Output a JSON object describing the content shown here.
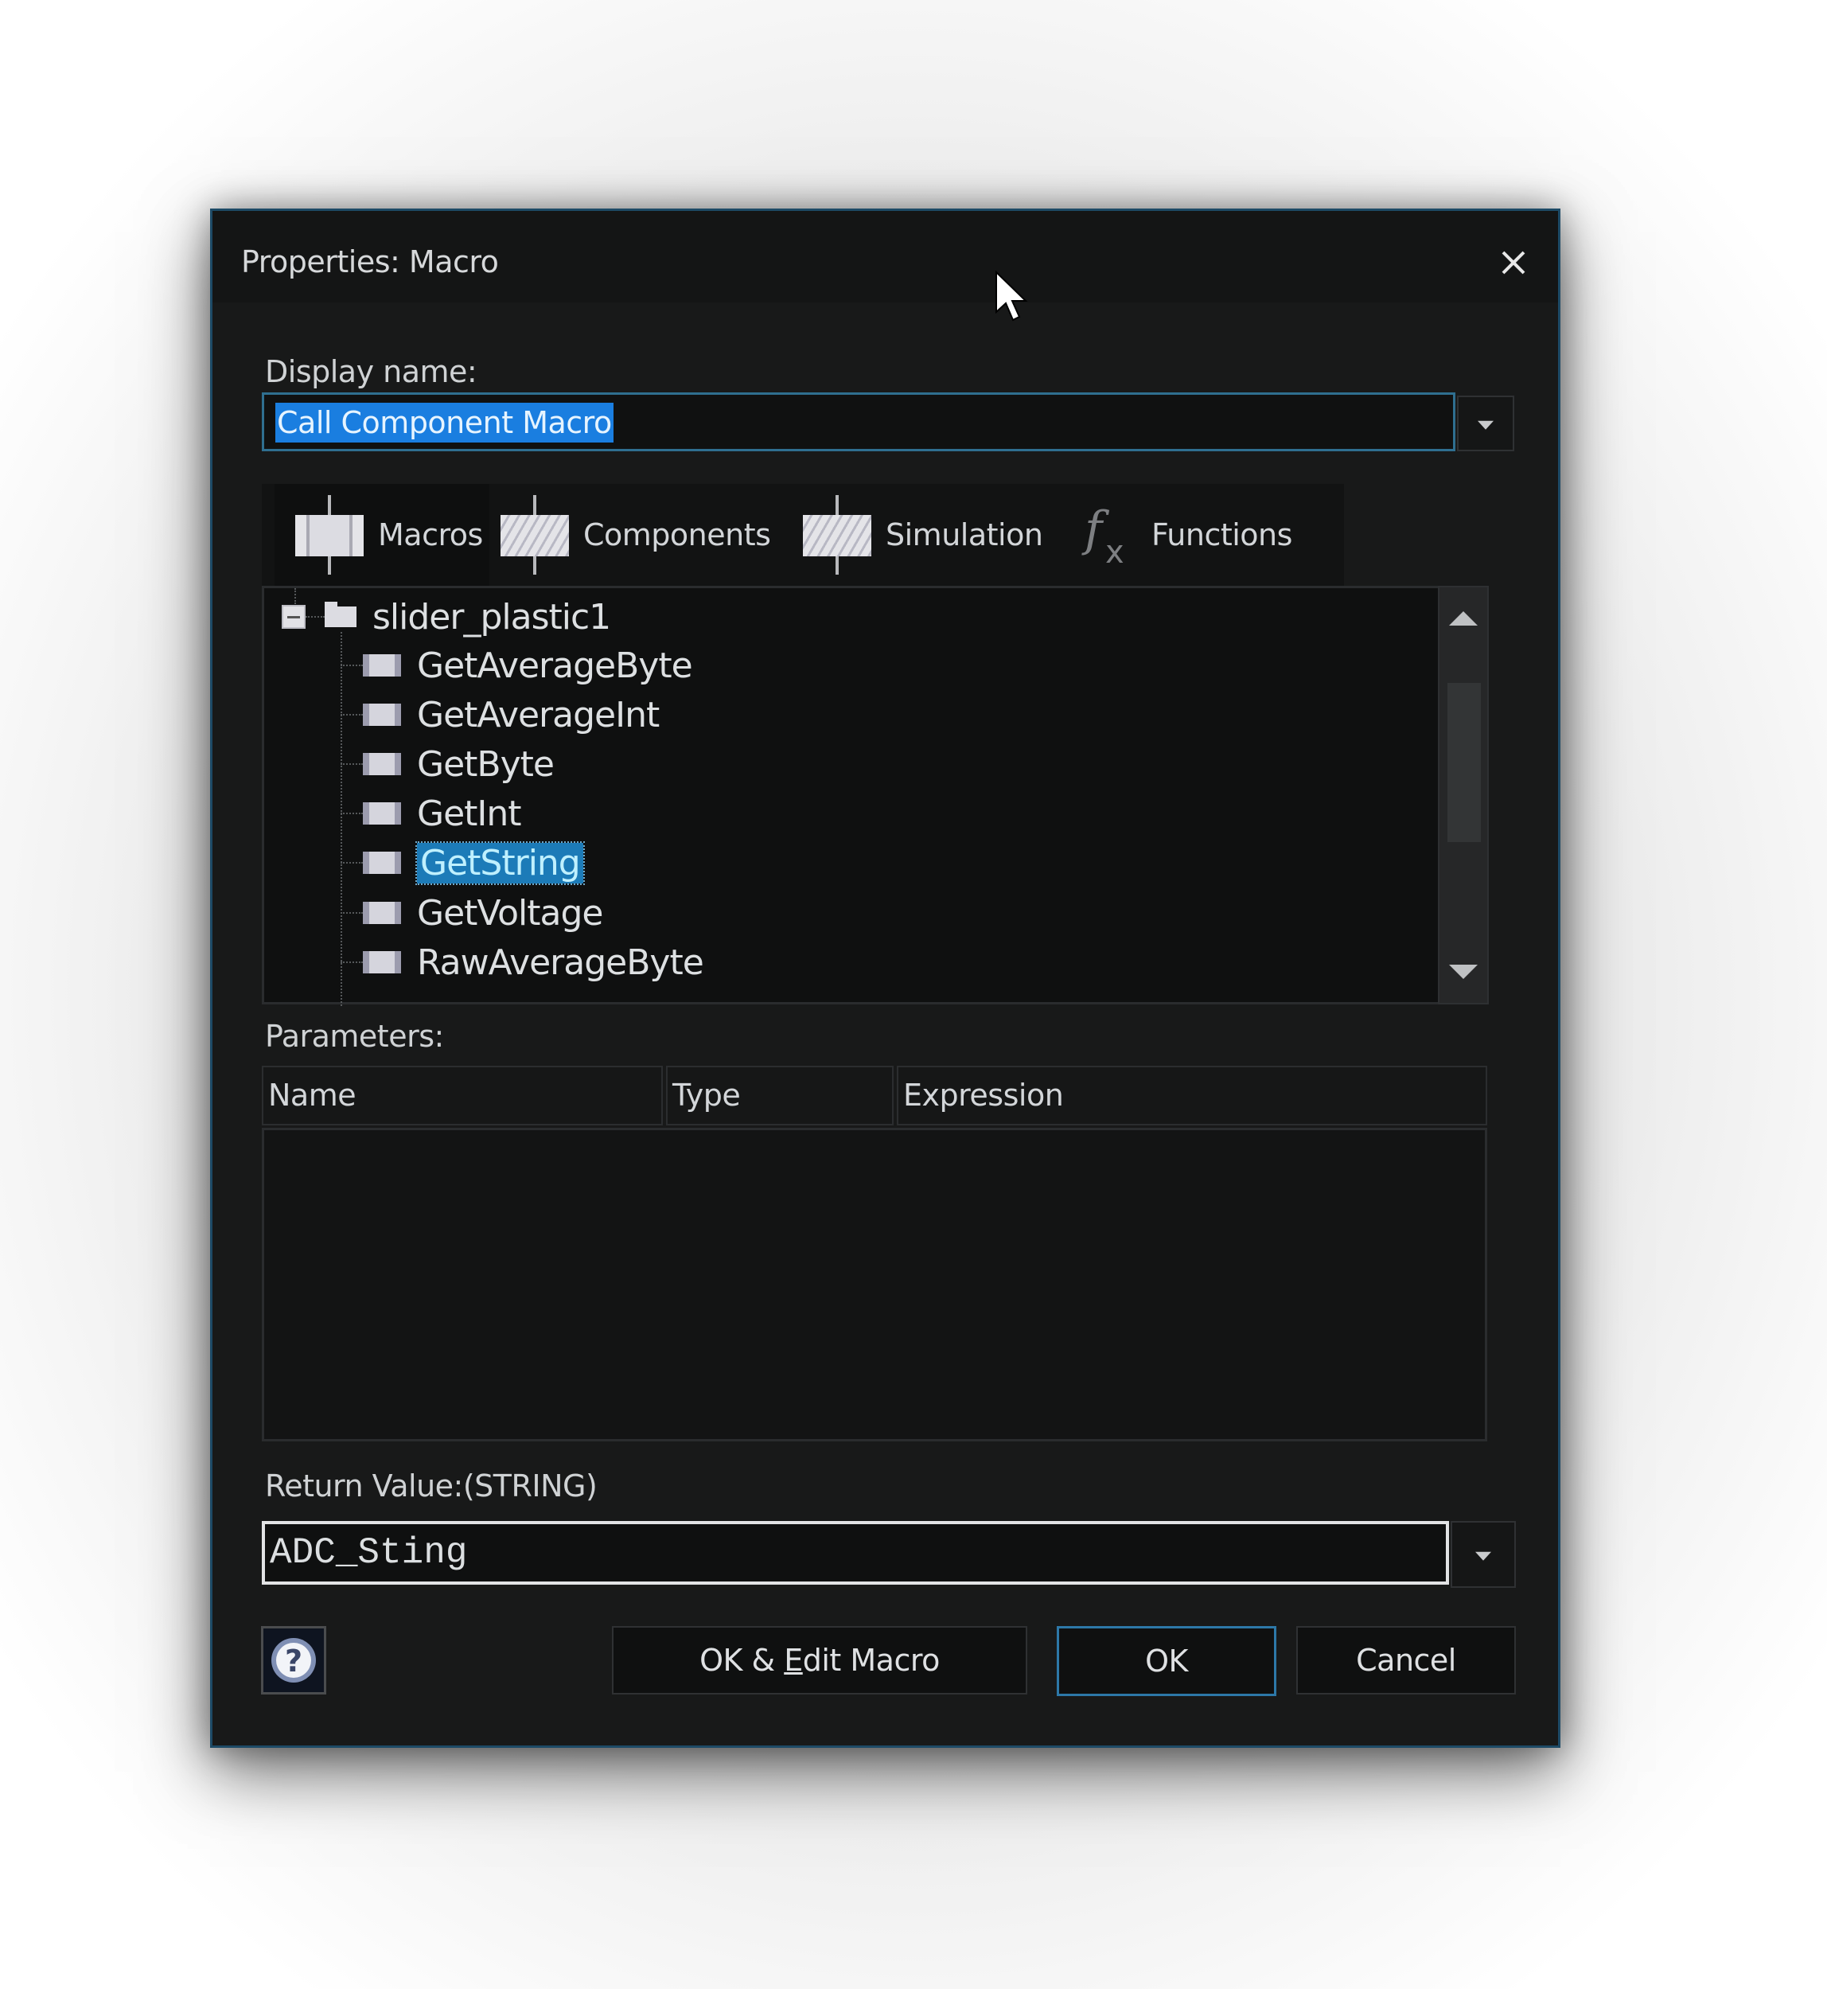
{
  "dialog": {
    "title": "Properties: Macro",
    "close_icon": "close-icon"
  },
  "display_name": {
    "label": "Display name:",
    "value": "Call Component Macro",
    "selected": true
  },
  "tabs": [
    {
      "label": "Macros",
      "icon": "macro-icon",
      "selected": true
    },
    {
      "label": "Components",
      "icon": "component-icon",
      "selected": false
    },
    {
      "label": "Simulation",
      "icon": "simulation-icon",
      "selected": false
    },
    {
      "label": "Functions",
      "icon": "fx-icon",
      "selected": false
    }
  ],
  "tree": {
    "root": {
      "label": "slider_plastic1",
      "expanded": true,
      "toggle_icon": "collapse-minus-icon",
      "icon": "folder-icon"
    },
    "items": [
      {
        "label": "GetAverageByte"
      },
      {
        "label": "GetAverageInt"
      },
      {
        "label": "GetByte"
      },
      {
        "label": "GetInt"
      },
      {
        "label": "GetString",
        "selected": true
      },
      {
        "label": "GetVoltage"
      },
      {
        "label": "RawAverageByte"
      }
    ]
  },
  "parameters": {
    "label": "Parameters:",
    "columns": [
      "Name",
      "Type",
      "Expression"
    ],
    "rows": []
  },
  "return_value": {
    "label": "Return Value:(STRING)",
    "value": "ADC_Sting"
  },
  "buttons": {
    "help_icon": "help-question-icon",
    "ok_edit_prefix": "OK & ",
    "ok_edit_mnemonic": "E",
    "ok_edit_suffix": "dit Macro",
    "ok": "OK",
    "cancel": "Cancel"
  },
  "colors": {
    "accent_border": "#2d78a8",
    "selection": "#1a7ee0",
    "tree_selection": "#1c7bb8",
    "background": "#181919"
  }
}
